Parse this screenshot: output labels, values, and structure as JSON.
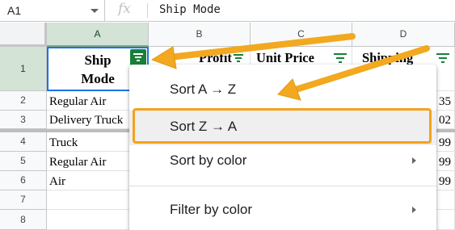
{
  "formula_bar": {
    "cell_ref": "A1",
    "fx": "fx",
    "value": "Ship Mode"
  },
  "columns": [
    "A",
    "B",
    "C",
    "D"
  ],
  "rows": [
    "1",
    "2",
    "3",
    "4",
    "5",
    "6",
    "7",
    "8"
  ],
  "header": {
    "a1": "Ship Mode",
    "b1": "Profit",
    "c1": "Unit Price",
    "d1": "Shipping"
  },
  "data_rows": [
    {
      "a": "Regular Air",
      "d": "35"
    },
    {
      "a": "Delivery Truck",
      "d": "02"
    },
    {
      "a": "Truck",
      "d": "99"
    },
    {
      "a": "Regular Air",
      "d": "99"
    },
    {
      "a": "Air",
      "d": "99"
    }
  ],
  "menu": {
    "items": [
      {
        "label": "Sort A → Z"
      },
      {
        "label": "Sort Z → A"
      },
      {
        "label": "Sort by color"
      },
      {
        "label": "Filter by color"
      }
    ]
  },
  "colors": {
    "accent_green": "#188038",
    "highlight_orange": "#f4a21c",
    "selection_blue": "#1a73e8"
  }
}
